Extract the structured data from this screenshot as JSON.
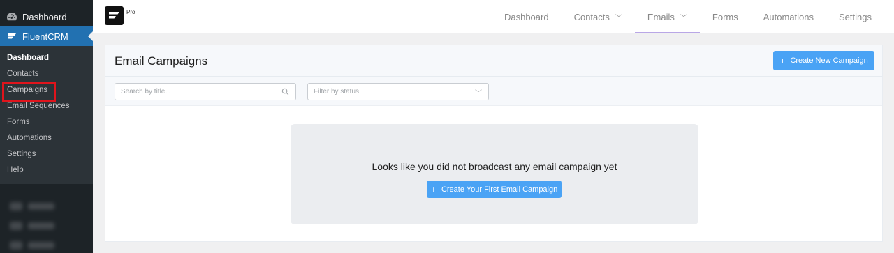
{
  "wp_sidebar": {
    "dashboard_label": "Dashboard",
    "fluentcrm_label": "FluentCRM",
    "submenu": [
      {
        "label": "Dashboard"
      },
      {
        "label": "Contacts"
      },
      {
        "label": "Campaigns"
      },
      {
        "label": "Email Sequences"
      },
      {
        "label": "Forms"
      },
      {
        "label": "Automations"
      },
      {
        "label": "Settings"
      },
      {
        "label": "Help"
      }
    ]
  },
  "topbar": {
    "logo_badge": "Pro",
    "nav": [
      {
        "label": "Dashboard"
      },
      {
        "label": "Contacts"
      },
      {
        "label": "Emails"
      },
      {
        "label": "Forms"
      },
      {
        "label": "Automations"
      },
      {
        "label": "Settings"
      }
    ]
  },
  "panel": {
    "title": "Email Campaigns",
    "create_button": "Create New Campaign",
    "search_placeholder": "Search by title...",
    "status_placeholder": "Filter by status",
    "empty_message": "Looks like you did not broadcast any email campaign yet",
    "first_campaign_button": "Create Your First Email Campaign"
  },
  "colors": {
    "wp_sidebar_bg": "#1d2327",
    "wp_active_menu": "#2271b1",
    "primary_button": "#4aa3f5",
    "highlight_box": "#e0141c",
    "active_tab_underline": "#b9a7e6"
  },
  "icons": {
    "dashboard": "dashboard-gauge-icon",
    "fluentcrm": "fluentcrm-logo-icon",
    "search": "search-icon",
    "chevron": "chevron-down-icon",
    "plus": "plus-icon"
  }
}
